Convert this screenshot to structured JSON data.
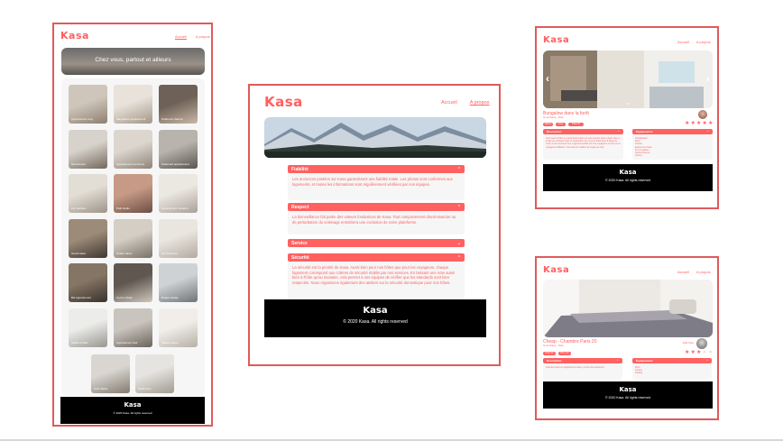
{
  "colors": {
    "brand": "#ff6060",
    "frame": "#e05a5a",
    "footer_bg": "#000000"
  },
  "brand": {
    "logo": "Kasa"
  },
  "nav": {
    "home": "Accueil",
    "about": "A propos"
  },
  "home_mockup": {
    "banner_text": "Chez vous, partout et ailleurs",
    "cards": [
      {
        "title": "Appartement cosy"
      },
      {
        "title": "Magnifique appartement"
      },
      {
        "title": "Studio de charme"
      },
      {
        "title": "Nid d'amour"
      },
      {
        "title": "Appartement Lumineux"
      },
      {
        "title": "Charmant appartement"
      },
      {
        "title": "Loft parisien"
      },
      {
        "title": "Petit studio"
      },
      {
        "title": "Appartement moderne"
      },
      {
        "title": "Grand salon"
      },
      {
        "title": "Studio calme"
      },
      {
        "title": "Loft lumineux"
      },
      {
        "title": "Bel appartement"
      },
      {
        "title": "Cocon urbain"
      },
      {
        "title": "Duplex design"
      },
      {
        "title": "Studio à Paris"
      },
      {
        "title": "Appartement clair"
      },
      {
        "title": "Maison calme"
      },
      {
        "title": "Chez Marie"
      },
      {
        "title": "Studio Zen"
      }
    ],
    "footer_text": "© 2020 Kasa. All rights reserved"
  },
  "about_mockup": {
    "sections": [
      {
        "title": "Fiabilité",
        "text": "Les annonces postées sur Kasa garantissent une fiabilité totale. Les photos sont conformes aux logements, et toutes les informations sont régulièrement vérifiées par nos équipes."
      },
      {
        "title": "Respect",
        "text": "La bienveillance fait partie des valeurs fondatrices de Kasa. Tout comportement discriminatoire ou de perturbation du voisinage entraînera une exclusion de notre plateforme."
      },
      {
        "title": "Service",
        "text": ""
      },
      {
        "title": "Sécurité",
        "text": "La sécurité est la priorité de Kasa. Aussi bien pour nos hôtes que pour les voyageurs, chaque logement correspond aux critères de sécurité établis par nos services. En laissant une note aussi bien à l'hôte qu'au locataire, cela permet à nos équipes de vérifier que les standards sont bien respectés. Nous organisons également des ateliers sur la sécurité domestique pour nos hôtes."
      }
    ],
    "footer_text": "© 2020 Kasa. All rights reserved"
  },
  "listing_mockup_1": {
    "title": "Bungalow dans la forêt",
    "location": "Ile de France - Paris",
    "tags": [
      "Nature",
      "Cosy",
      "Paris 10"
    ],
    "rating": 5,
    "gallery_counter": "1/4",
    "description_title": "Description",
    "description_text": "Vous serez à 50m du canal Saint-martin où vous pourrez pique-niquer l'été et à côté de nombreux bars et restaurants. Au cœur de Paris avec 5 lignes de métro et de nombreux bus. Logement parfait pour les voyageurs en solo et les voyageurs d'affaires. Vous êtes à 1 station de la gare de l'est.",
    "equipment_title": "Équipements",
    "equipment": [
      "Climatisation",
      "Wi-Fi",
      "Cuisine",
      "Espace de travail",
      "Fer à repasser",
      "Sèche-cheveux",
      "Cintres"
    ],
    "footer_text": "© 2020 Kasa. All rights reserved"
  },
  "listing_mockup_2": {
    "title": "Cheap - Chambre Paris 20",
    "location": "Ile de France - Paris",
    "tags": [
      "Paris 20",
      "Bon prix"
    ],
    "host_name": "Della Case",
    "rating": 3,
    "description_title": "Description",
    "description_text": "Chambre dans un appartement calme, proche des transports.",
    "equipment_title": "Équipements",
    "equipment": [
      "Wi-Fi",
      "Cuisine",
      "Parking"
    ],
    "footer_text": "© 2020 Kasa. All rights reserved"
  }
}
